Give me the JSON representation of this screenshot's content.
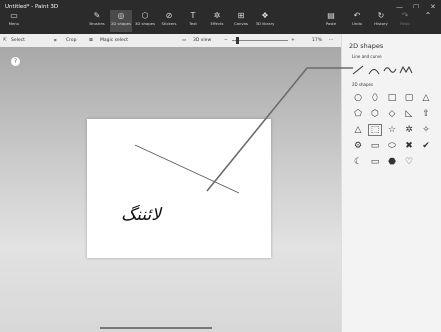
{
  "window": {
    "title": "Untitled* - Paint 3D",
    "controls": [
      "—",
      "□",
      "✕"
    ]
  },
  "ribbon": {
    "menu_label": "Menu",
    "tools": [
      {
        "label": "Brushes",
        "icon": "brush-icon"
      },
      {
        "label": "2D shapes",
        "icon": "2d-shapes-icon"
      },
      {
        "label": "3D shapes",
        "icon": "3d-shapes-icon"
      },
      {
        "label": "Stickers",
        "icon": "stickers-icon"
      },
      {
        "label": "Text",
        "icon": "text-icon"
      },
      {
        "label": "Effects",
        "icon": "effects-icon"
      },
      {
        "label": "Canvas",
        "icon": "canvas-icon"
      },
      {
        "label": "3D library",
        "icon": "3d-library-icon"
      }
    ],
    "actions": [
      {
        "label": "Paste",
        "icon": "paste-icon"
      },
      {
        "label": "Undo",
        "icon": "undo-icon"
      },
      {
        "label": "History",
        "icon": "history-icon"
      },
      {
        "label": "Redo",
        "icon": "redo-icon"
      }
    ]
  },
  "toolbar": {
    "select": "Select",
    "crop": "Crop",
    "magic_select": "Magic select",
    "view_3d": "3D view",
    "zoom": "17%",
    "more": "···"
  },
  "canvas": {
    "text": "لائننگ",
    "help": "?"
  },
  "panel": {
    "title": "2D shapes",
    "line_and_curve_label": "Line and curve",
    "shapes_label": "2D shapes",
    "line_icons": [
      "line-icon",
      "curve-icon",
      "wave-icon",
      "zigzag-icon"
    ],
    "shape_glyphs": [
      "○",
      "⬯",
      "□",
      "▢",
      "△",
      "⬠",
      "⬡",
      "◇",
      "◺",
      "⇧",
      "△",
      "⬚",
      "☆",
      "✲",
      "✧",
      "⚙",
      "▭",
      "⬭",
      "✖",
      "✔",
      "☾",
      "▭",
      "⬣",
      "♡"
    ]
  },
  "colors": {
    "title_bg": "#2b2b2b",
    "panel_bg": "#f3f3f3",
    "selected_tab": "#4a4a4a"
  }
}
